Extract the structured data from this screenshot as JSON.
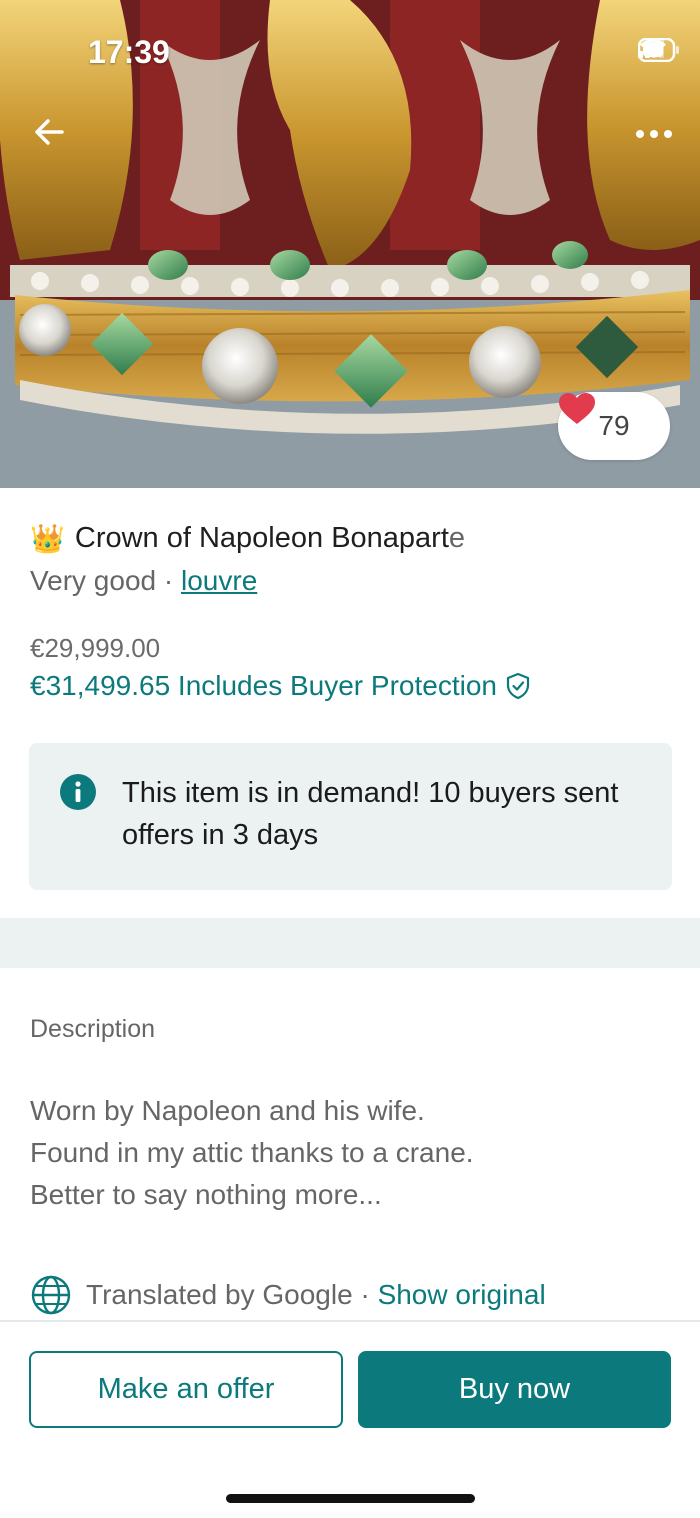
{
  "status_bar": {
    "time": "17:39",
    "icons": [
      "signal-icon",
      "wifi-icon",
      "battery-icon"
    ]
  },
  "header": {
    "back_icon": "arrow-left-icon",
    "more_icon": "more-dots-icon"
  },
  "photo": {
    "subject": "gold-crown-photo",
    "likes": "79",
    "like_icon": "heart-icon",
    "like_color": "#e23b4e"
  },
  "item": {
    "emoji": "👑",
    "title_main": "Crown of Napoleon Bonapart",
    "title_last": "e",
    "condition": "Very good",
    "separator": "·",
    "brand": "louvre",
    "price": "€29,999.00",
    "price_total": "€31,499.65 Includes Buyer Protection",
    "protection_icon": "shield-check-icon"
  },
  "demand_notice": {
    "icon": "info-icon",
    "text": "This item is in demand! 10 buyers sent offers in 3 days"
  },
  "description": {
    "label": "Description",
    "lines": [
      "Worn by Napoleon and his wife.",
      "Found in my attic thanks to a crane.",
      "Better to say nothing more..."
    ]
  },
  "translation": {
    "icon": "globe-icon",
    "text": "Translated by Google",
    "separator": "·",
    "link": "Show original"
  },
  "actions": {
    "offer_label": "Make an offer",
    "buy_label": "Buy now"
  },
  "colors": {
    "accent": "#0c7a7d",
    "notice_bg": "#ecf2f2",
    "heart": "#e23b4e"
  }
}
